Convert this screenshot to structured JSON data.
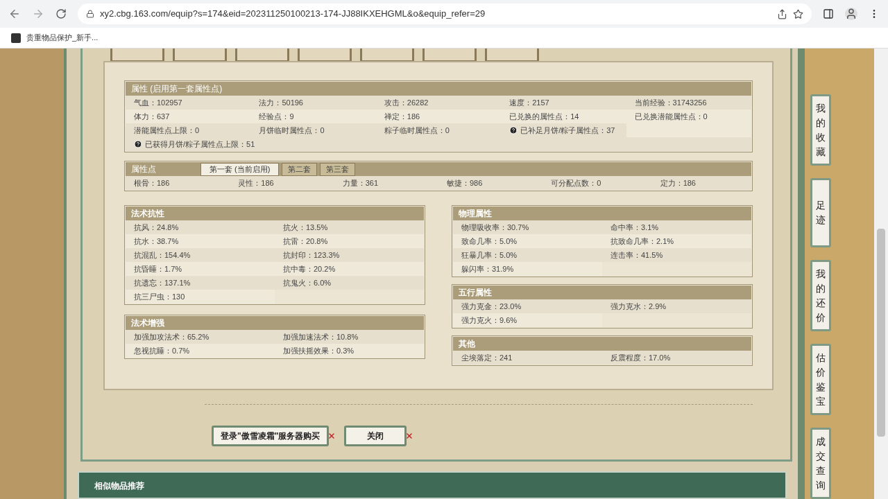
{
  "browser": {
    "url": "xy2.cbg.163.com/equip?s=174&eid=202311250100213-174-JJ88IKXEHGML&o&equip_refer=29",
    "bookmark": "贵重物品保护_新手..."
  },
  "attributes": {
    "title": "属性 (启用第一套属性点)",
    "items": [
      {
        "text": "气血：102957",
        "help": false
      },
      {
        "text": "法力：50196",
        "help": false
      },
      {
        "text": "攻击：26282",
        "help": false
      },
      {
        "text": "速度：2157",
        "help": false
      },
      {
        "text": "当前经验：31743256",
        "help": false
      },
      {
        "text": "体力：637",
        "help": false
      },
      {
        "text": "经验点：9",
        "help": false
      },
      {
        "text": "禅定：186",
        "help": false
      },
      {
        "text": "已兑换的属性点：14",
        "help": false
      },
      {
        "text": "已兑换潜能属性点：0",
        "help": false
      },
      {
        "text": "潜能属性点上限：0",
        "help": false
      },
      {
        "text": "月饼临时属性点：0",
        "help": false
      },
      {
        "text": "粽子临时属性点：0",
        "help": false
      },
      {
        "text": "已补足月饼/粽子属性点：37",
        "help": true
      }
    ],
    "note": {
      "text": "已获得月饼/粽子属性点上限：51",
      "help": true
    }
  },
  "points": {
    "title": "属性点",
    "tabs": [
      {
        "label": "第一套 (当前启用)",
        "selected": true
      },
      {
        "label": "第二套",
        "selected": false
      },
      {
        "label": "第三套",
        "selected": false
      }
    ],
    "values": [
      "根骨：186",
      "灵性：186",
      "力量：361",
      "敏捷：986",
      "可分配点数：0",
      "定力：186"
    ]
  },
  "left_panels": [
    {
      "title": "法术抗性",
      "items": [
        "抗风：24.8%",
        "抗火：13.5%",
        "抗水：38.7%",
        "抗雷：20.8%",
        "抗混乱：154.4%",
        "抗封印：123.3%",
        "抗昏睡：1.7%",
        "抗中毒：20.2%",
        "抗遗忘：137.1%",
        "抗鬼火：6.0%",
        "抗三尸虫：130"
      ]
    },
    {
      "title": "法术增强",
      "items": [
        "加强加攻法术：65.2%",
        "加强加速法术：10.8%",
        "忽视抗睡：0.7%",
        "加强扶摇效果：0.3%"
      ]
    }
  ],
  "right_panels": [
    {
      "title": "物理属性",
      "items": [
        "物理吸收率：30.7%",
        "命中率：3.1%",
        "致命几率：5.0%",
        "抗致命几率：2.1%",
        "狂暴几率：5.0%",
        "连击率：41.5%",
        "躲闪率：31.9%"
      ]
    },
    {
      "title": "五行属性",
      "items": [
        "强力克金：23.0%",
        "强力克水：2.9%",
        "强力克火：9.6%"
      ]
    },
    {
      "title": "其他",
      "items": [
        "尘埃落定：241",
        "反震程度：17.0%"
      ]
    }
  ],
  "buttons": [
    {
      "label": "登录\"傲雪凌霜\"服务器购买"
    },
    {
      "label": "关闭"
    }
  ],
  "similar": {
    "title": "相似物品推荐"
  },
  "sidebar": [
    {
      "label": "我的收藏"
    },
    {
      "label": "足迹"
    },
    {
      "label": "我的还价"
    },
    {
      "label": "估价鉴宝"
    },
    {
      "label": "成交查询"
    }
  ]
}
